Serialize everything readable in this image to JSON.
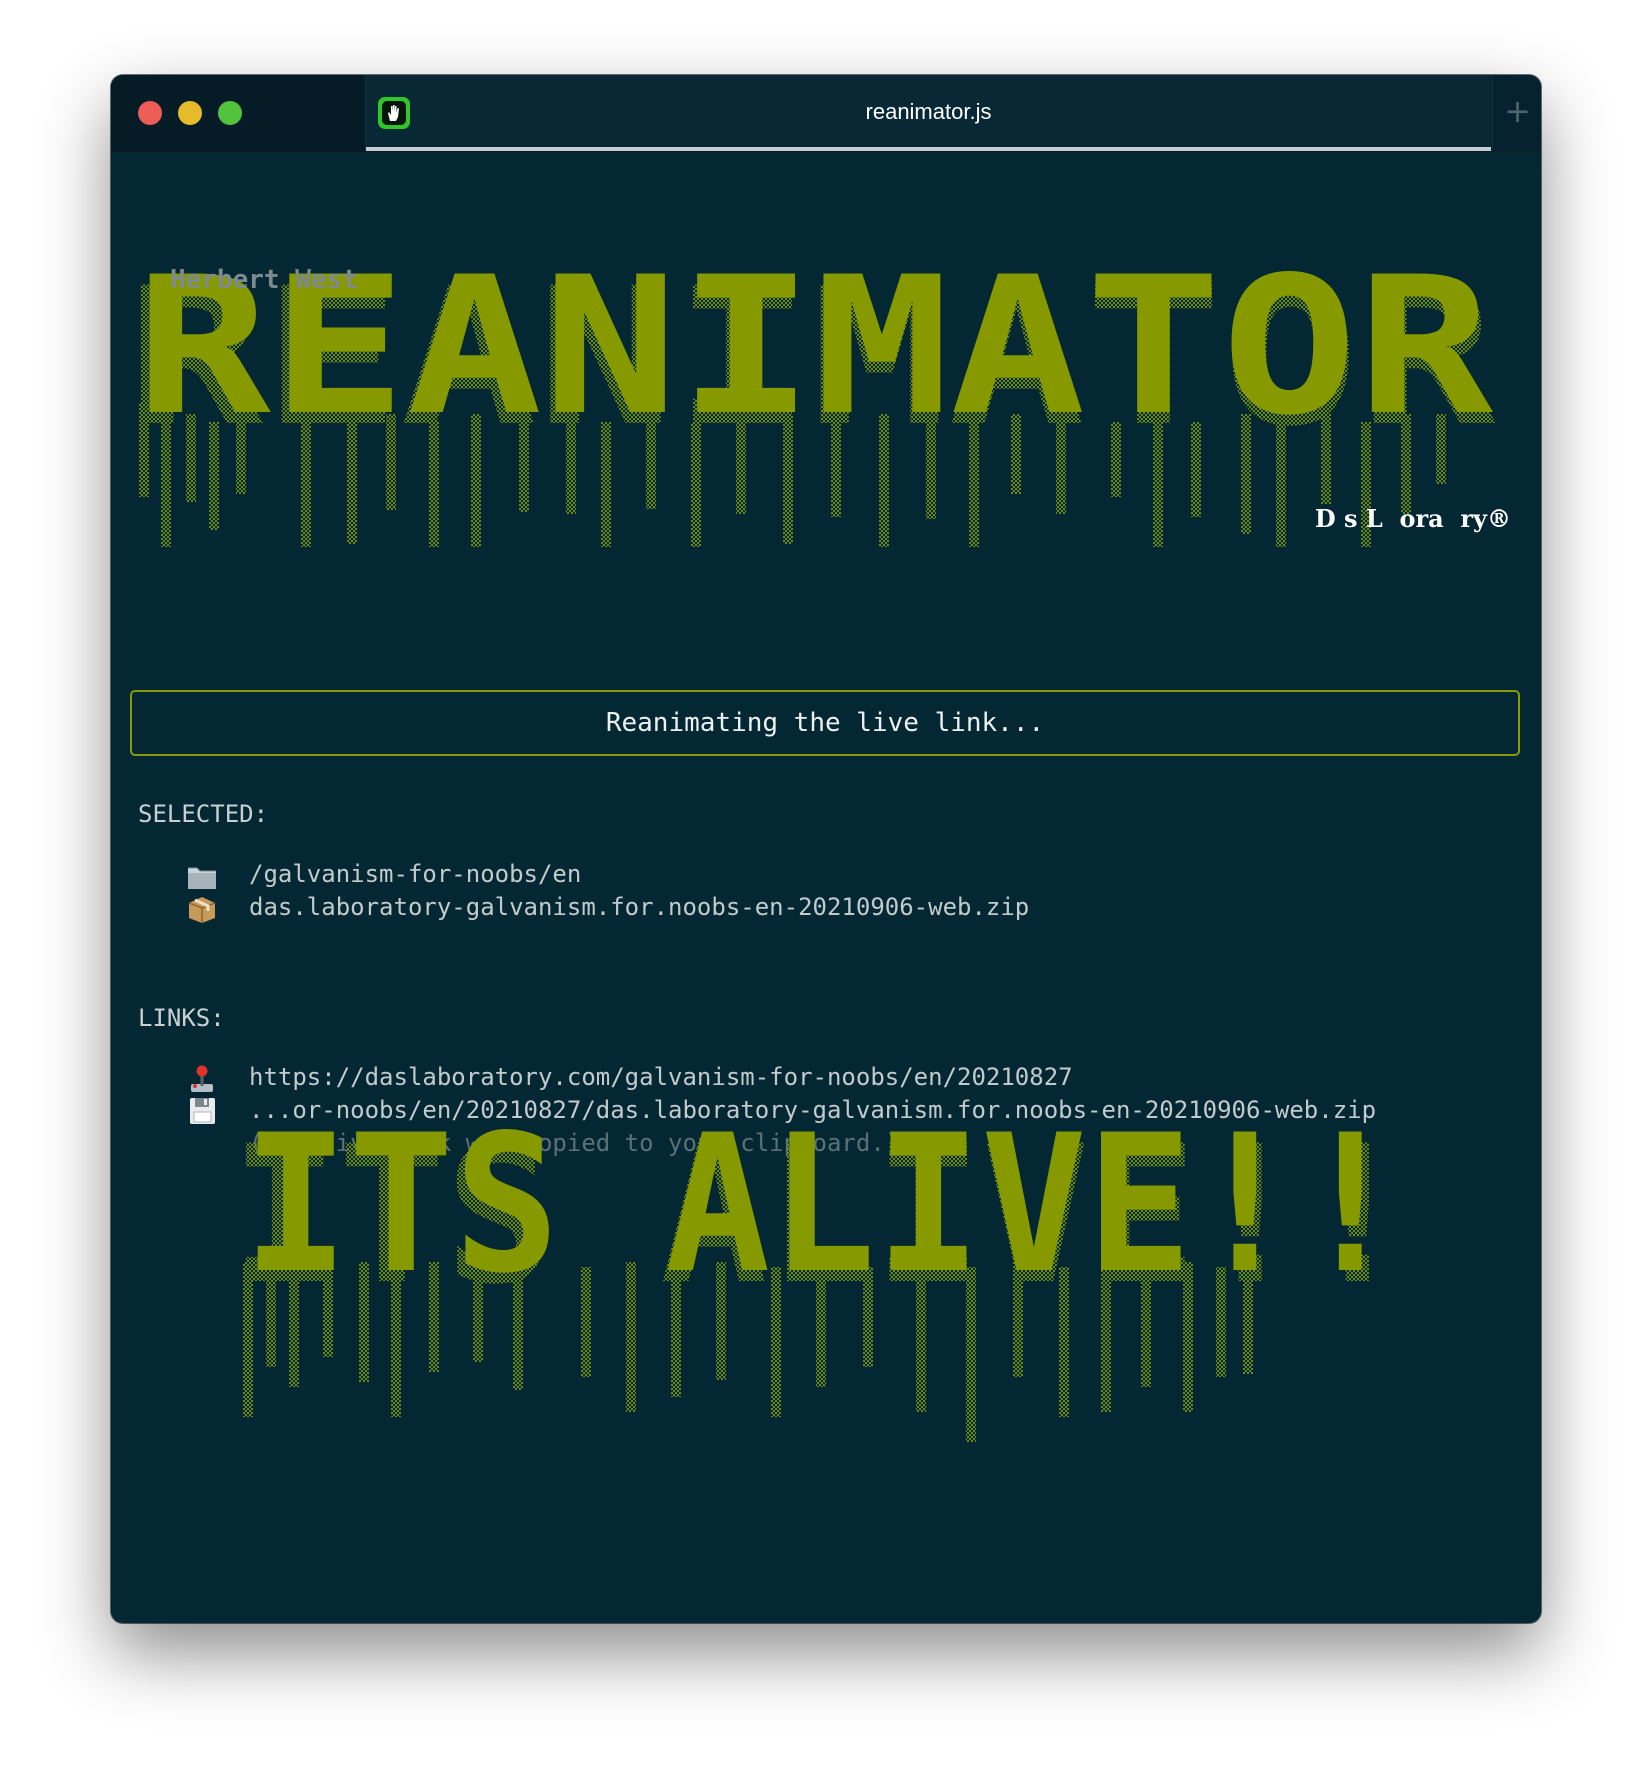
{
  "window": {
    "tab_title": "reanimator.js",
    "new_tab_glyph": "+"
  },
  "header": {
    "author": "Herbert West",
    "logo_text": "REANIMATOR",
    "subtitle": "D s L  ora  ry®"
  },
  "status": {
    "message": "Reanimating the live link..."
  },
  "selected": {
    "label": "SELECTED:",
    "folder_icon": "folder-icon",
    "folder_path": "/galvanism-for-noobs/en",
    "package_icon": "package-icon",
    "archive_name": "das.laboratory-galvanism.for.noobs-en-20210906-web.zip"
  },
  "links": {
    "label": "LINKS:",
    "joystick_icon": "joystick-icon",
    "page_url": "https://daslaboratory.com/galvanism-for-noobs/en/20210827",
    "disk_icon": "floppy-disk-icon",
    "file_url": "...or-noobs/en/20210827/das.laboratory-galvanism.for.noobs-en-20210906-web.zip",
    "clipboard_note": "(The live link was copied to your clipboard.)"
  },
  "banner": {
    "text": "ITS ALIVE!!"
  },
  "colors": {
    "background": "#032733",
    "accent": "#869a00",
    "accent_dim": "#6e8a0c",
    "text": "#c3cacc"
  }
}
